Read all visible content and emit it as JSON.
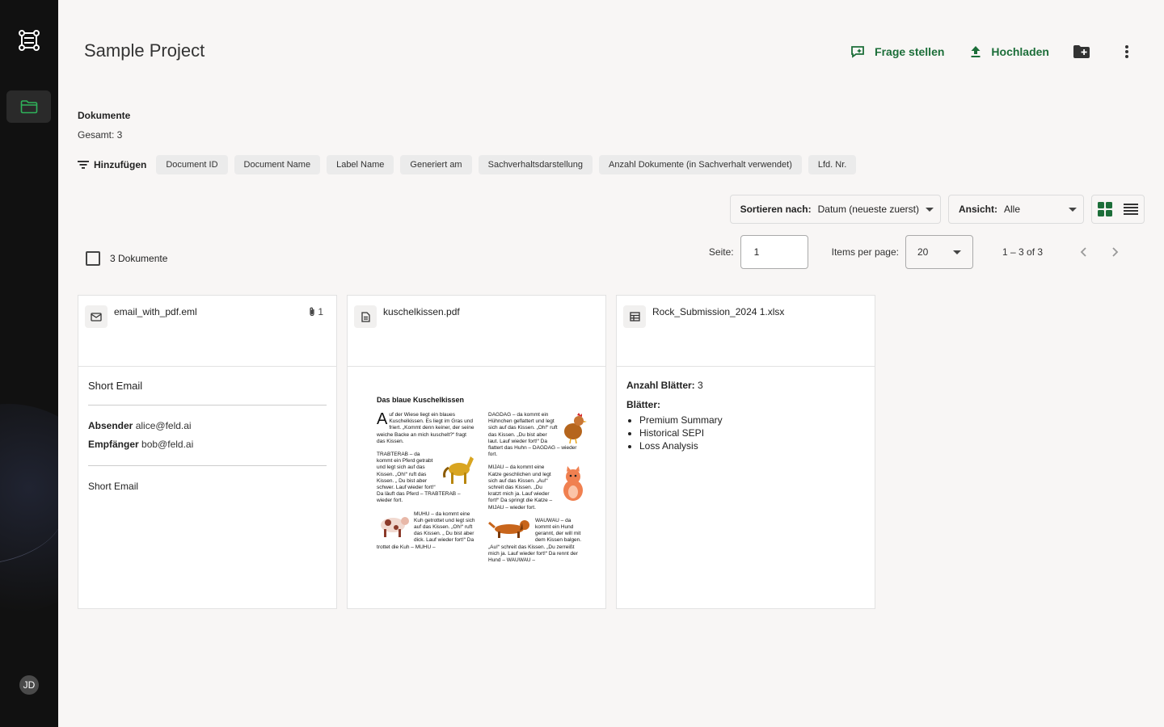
{
  "user": {
    "initials": "JD"
  },
  "header": {
    "title": "Sample Project",
    "ask_label": "Frage stellen",
    "upload_label": "Hochladen"
  },
  "section": {
    "title": "Dokumente",
    "total": "Gesamt: 3"
  },
  "filters": {
    "add_label": "Hinzufügen",
    "chips": [
      "Document ID",
      "Document Name",
      "Label Name",
      "Generiert am",
      "Sachverhaltsdarstellung",
      "Anzahl Dokumente (in Sachverhalt verwendet)",
      "Lfd. Nr."
    ]
  },
  "toolbar": {
    "sort_label": "Sortieren nach:",
    "sort_value": "Datum (neueste zuerst)",
    "view_label": "Ansicht:",
    "view_value": "Alle",
    "view_mode": "grid"
  },
  "selection": {
    "label": "3 Dokumente"
  },
  "pagination": {
    "page_label": "Seite:",
    "page_value": "1",
    "ipp_label": "Items per page:",
    "ipp_value": "20",
    "range": "1 – 3 of 3"
  },
  "cards": [
    {
      "type": "email",
      "name": "email_with_pdf.eml",
      "attachments": "1",
      "subject": "Short Email",
      "sender_label": "Absender",
      "sender": "alice@feld.ai",
      "recipient_label": "Empfänger",
      "recipient": "bob@feld.ai",
      "body": "Short Email"
    },
    {
      "type": "pdf",
      "name": "kuschelkissen.pdf",
      "preview": {
        "title": "Das blaue Kuschelkissen",
        "left": [
          "uf der Wiese liegt ein blaues Kuschelkissen. Es liegt im Gras und friert. „Kommt denn keiner, der seine weiche Backe an mich kuschelt?“ fragt das Kissen.",
          "TRABTERAB – da kommt ein Pferd getrabt und legt sich auf das Kissen. „Oh!“ ruft das Kissen. „ Du bist aber schwer. Lauf wieder fort!“ Da läuft das Pferd – TRABTERAB – wieder fort.",
          "MUHU – da kommt eine Kuh getrottet und legt sich auf das Kissen. „Oh!“ ruft das Kissen. „ Du bist aber dick. Lauf wieder fort!“ Da trottet die Kuh – MUHU –"
        ],
        "dropcap": "A",
        "right": [
          "DAGDAG – da kommt ein Hühnchen geflattert und legt sich auf das Kissen. „Oh!“ ruft das Kissen. „Du bist aber laut. Lauf wieder fort!“ Da flattert das Huhn – DAGDAG – wieder fort.",
          "MIJAU – da kommt eine Katze geschlichen und legt sich auf das Kissen. „Au!“ schreit das Kissen. „Du kratzt mich ja. Lauf wieder fort!“ Da springt die Katze – MIJAU – wieder fort.",
          "WAUWAU – da kommt ein Hund gerannt, der will mit dem Kissen balgen. „Au!“ schreit das Kissen. „Du zerreißt mich ja. Lauf wieder fort!“ Da rennt der Hund – WAUWAU –"
        ]
      }
    },
    {
      "type": "spreadsheet",
      "name": "Rock_Submission_2024 1.xlsx",
      "sheet_count_label": "Anzahl Blätter:",
      "sheet_count": "3",
      "sheets_label": "Blätter:",
      "sheets": [
        "Premium Summary",
        "Historical SEPI",
        "Loss Analysis"
      ]
    }
  ],
  "icons": {
    "logo": "logo-icon",
    "nav": "folder-icon",
    "ask": "ask-question-icon",
    "upload": "upload-icon",
    "new_folder": "folder-plus-icon",
    "more": "more-vert-icon"
  },
  "colors": {
    "accent": "#1c6e39",
    "sidebar": "#111111",
    "background": "#f8f6f5"
  }
}
